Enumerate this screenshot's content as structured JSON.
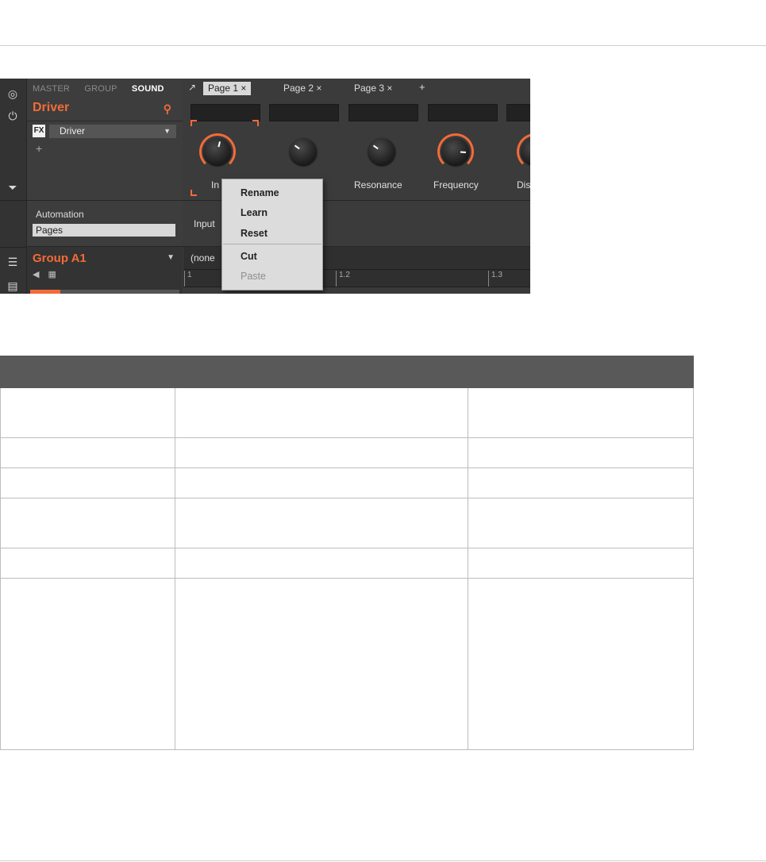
{
  "screenshot": {
    "sidebar_tabs": [
      {
        "label": "MASTER",
        "active": false
      },
      {
        "label": "GROUP",
        "active": false
      },
      {
        "label": "SOUND",
        "active": true
      }
    ],
    "sound_name": "Driver",
    "fx_badge": "FX",
    "plugin_name": "Driver",
    "add_plugin": "+",
    "page_tabs": [
      {
        "label": "Page 1 ×",
        "active": true
      },
      {
        "label": "Page 2 ×",
        "active": false
      },
      {
        "label": "Page 3 ×",
        "active": false
      }
    ],
    "add_page": "+",
    "knobs": [
      {
        "label": "In",
        "value": 0.55,
        "ring": "#f26b38"
      },
      {
        "label": "",
        "value": 0.3,
        "ring": ""
      },
      {
        "label": "Resonance",
        "value": 0.3,
        "ring": ""
      },
      {
        "label": "Frequency",
        "value": 0.85,
        "ring": "#f26b38"
      },
      {
        "label": "Dis",
        "value": 0.5,
        "ring": "#f26b38"
      }
    ],
    "automation_label": "Automation",
    "pages_label": "Pages",
    "input_label": "Input",
    "group_name": "Group A1",
    "pattern_label": "(none",
    "ruler_ticks": [
      "1",
      "1.2",
      "1.3"
    ],
    "context_menu": {
      "items": [
        {
          "label": "Rename",
          "enabled": true
        },
        {
          "label": "Learn",
          "enabled": true
        },
        {
          "label": "Reset",
          "enabled": true
        },
        {
          "label": "Cut",
          "enabled": true
        },
        {
          "label": "Paste",
          "enabled": false
        }
      ]
    },
    "accent_color": "#f26b38"
  },
  "table": {
    "header_color": "#595959",
    "columns": 3,
    "rows": 6
  }
}
